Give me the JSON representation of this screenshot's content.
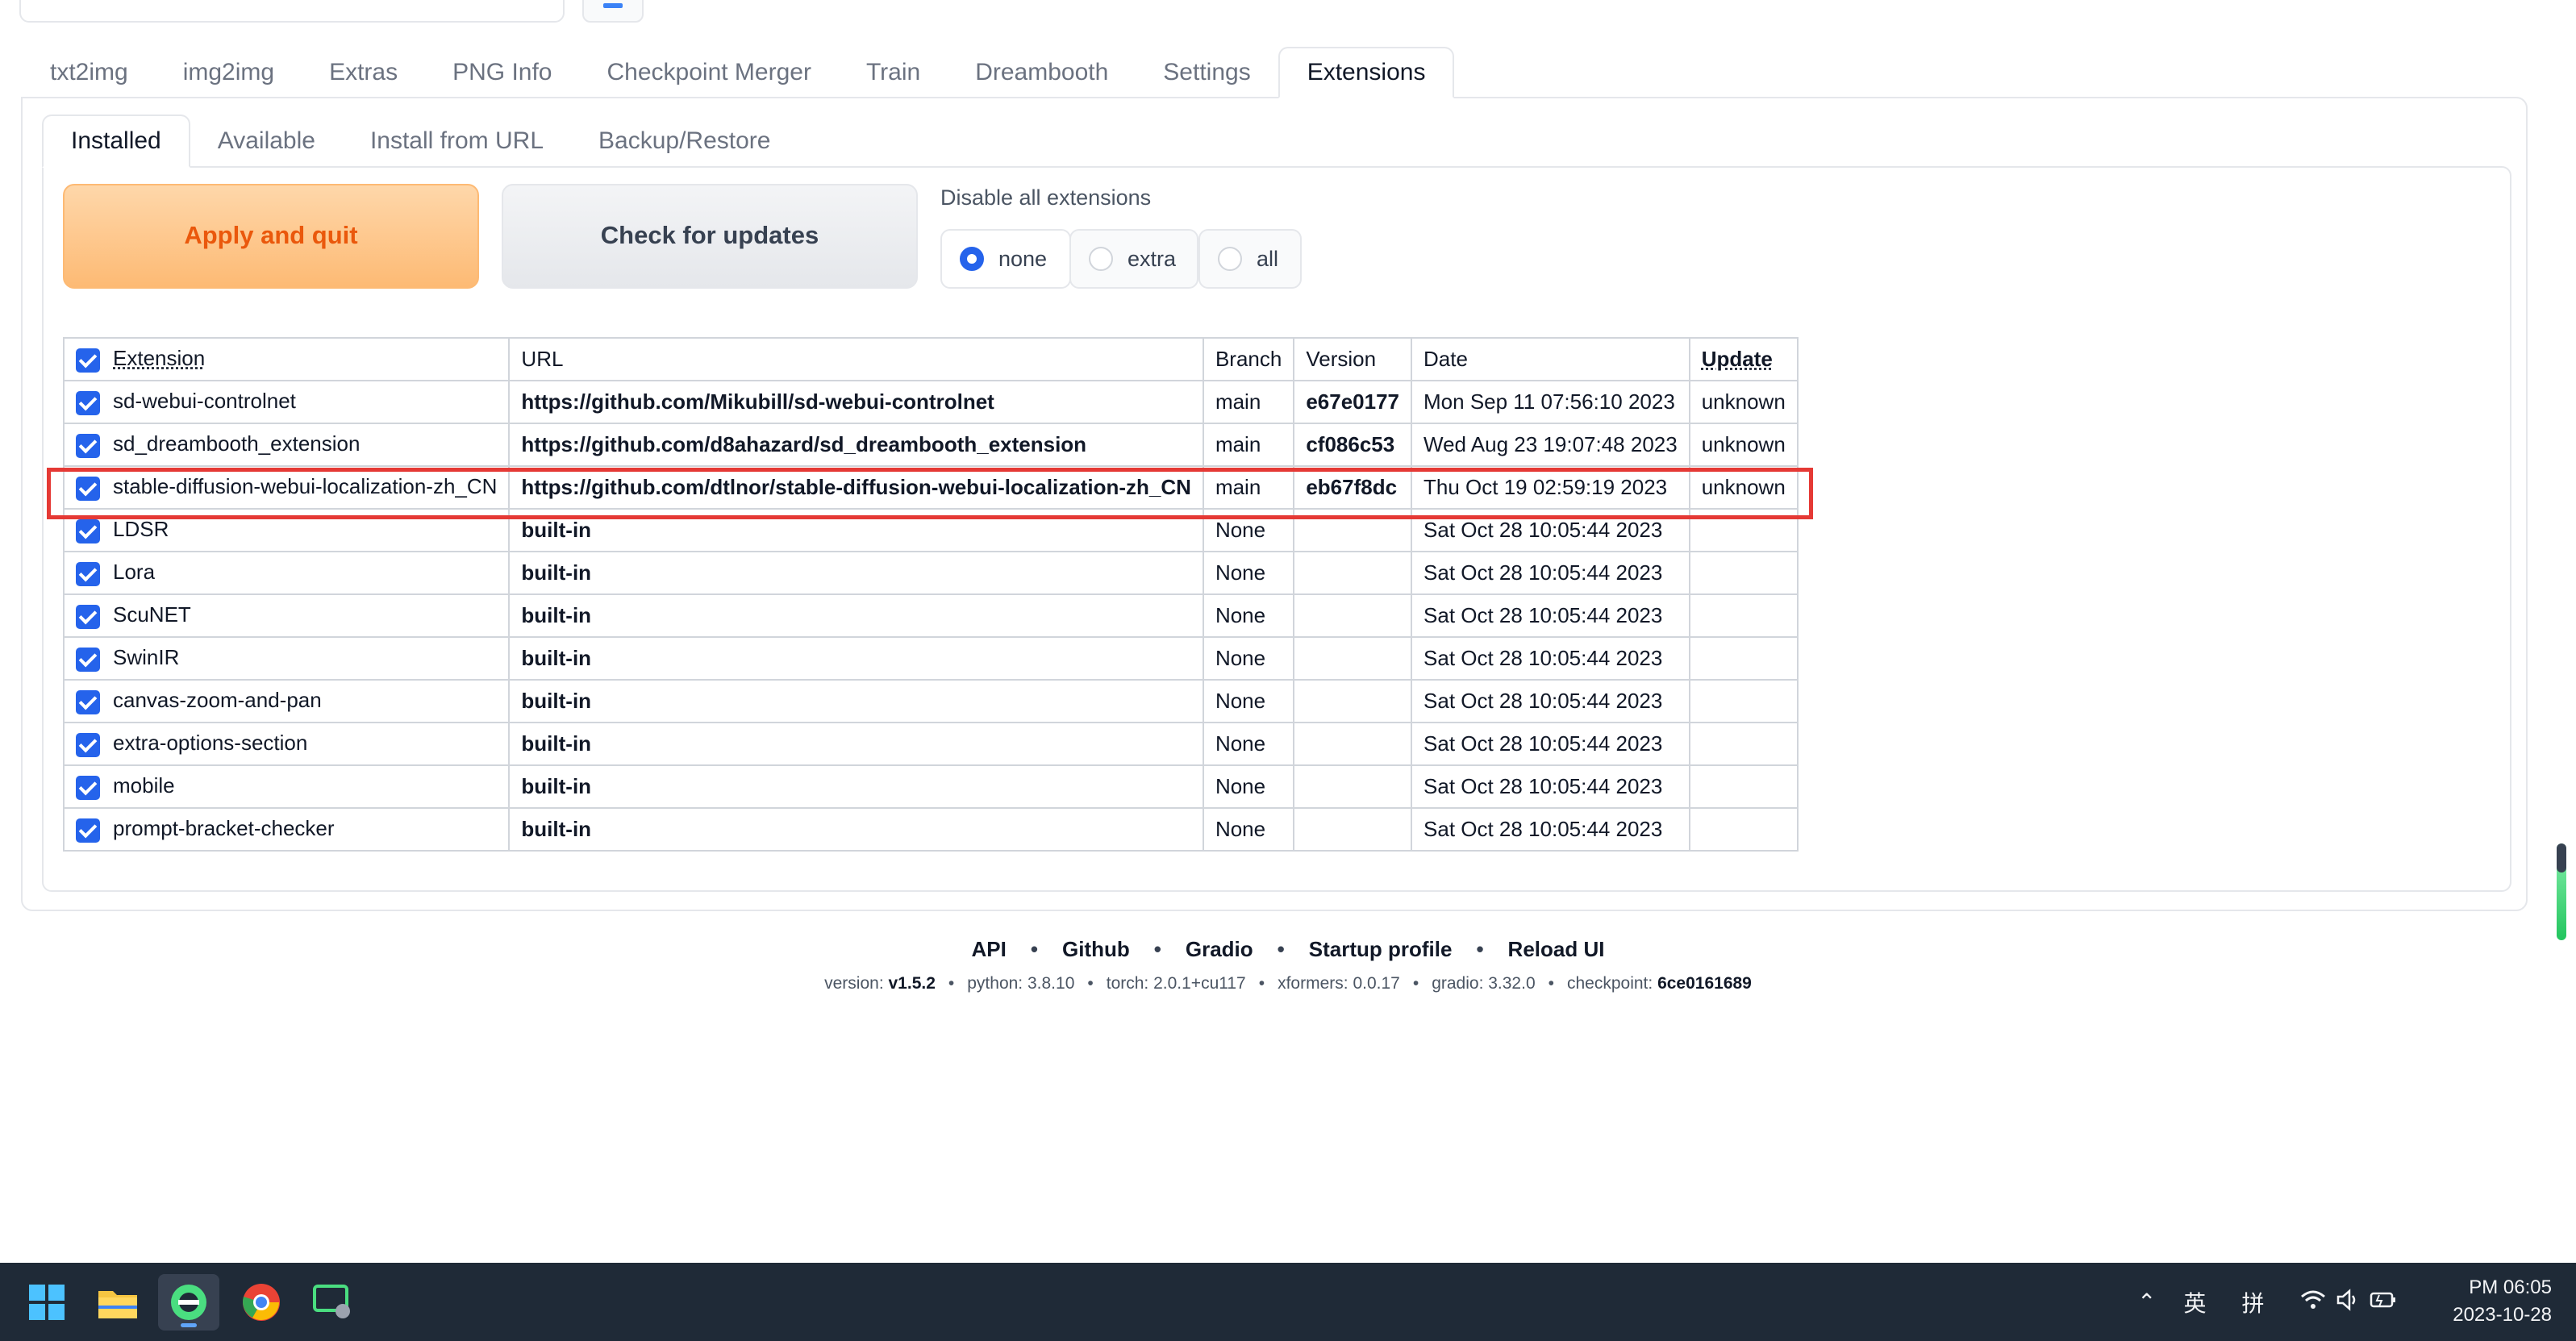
{
  "main_tabs": [
    "txt2img",
    "img2img",
    "Extras",
    "PNG Info",
    "Checkpoint Merger",
    "Train",
    "Dreambooth",
    "Settings",
    "Extensions"
  ],
  "active_main_tab": "Extensions",
  "sub_tabs": [
    "Installed",
    "Available",
    "Install from URL",
    "Backup/Restore"
  ],
  "active_sub_tab": "Installed",
  "buttons": {
    "apply": "Apply and quit",
    "check": "Check for updates"
  },
  "disable": {
    "label": "Disable all extensions",
    "options": [
      "none",
      "extra",
      "all"
    ],
    "selected": "none"
  },
  "table": {
    "headers": [
      "Extension",
      "URL",
      "Branch",
      "Version",
      "Date",
      "Update"
    ],
    "rows": [
      {
        "name": "sd-webui-controlnet",
        "url": "https://github.com/Mikubill/sd-webui-controlnet",
        "branch": "main",
        "version": "e67e0177",
        "date": "Mon Sep 11 07:56:10 2023",
        "update": "unknown"
      },
      {
        "name": "sd_dreambooth_extension",
        "url": "https://github.com/d8ahazard/sd_dreambooth_extension",
        "branch": "main",
        "version": "cf086c53",
        "date": "Wed Aug 23 19:07:48 2023",
        "update": "unknown"
      },
      {
        "name": "stable-diffusion-webui-localization-zh_CN",
        "url": "https://github.com/dtlnor/stable-diffusion-webui-localization-zh_CN",
        "branch": "main",
        "version": "eb67f8dc",
        "date": "Thu Oct 19 02:59:19 2023",
        "update": "unknown"
      },
      {
        "name": "LDSR",
        "url": "built-in",
        "branch": "None",
        "version": "",
        "date": "Sat Oct 28 10:05:44 2023",
        "update": ""
      },
      {
        "name": "Lora",
        "url": "built-in",
        "branch": "None",
        "version": "",
        "date": "Sat Oct 28 10:05:44 2023",
        "update": ""
      },
      {
        "name": "ScuNET",
        "url": "built-in",
        "branch": "None",
        "version": "",
        "date": "Sat Oct 28 10:05:44 2023",
        "update": ""
      },
      {
        "name": "SwinIR",
        "url": "built-in",
        "branch": "None",
        "version": "",
        "date": "Sat Oct 28 10:05:44 2023",
        "update": ""
      },
      {
        "name": "canvas-zoom-and-pan",
        "url": "built-in",
        "branch": "None",
        "version": "",
        "date": "Sat Oct 28 10:05:44 2023",
        "update": ""
      },
      {
        "name": "extra-options-section",
        "url": "built-in",
        "branch": "None",
        "version": "",
        "date": "Sat Oct 28 10:05:44 2023",
        "update": ""
      },
      {
        "name": "mobile",
        "url": "built-in",
        "branch": "None",
        "version": "",
        "date": "Sat Oct 28 10:05:44 2023",
        "update": ""
      },
      {
        "name": "prompt-bracket-checker",
        "url": "built-in",
        "branch": "None",
        "version": "",
        "date": "Sat Oct 28 10:05:44 2023",
        "update": ""
      }
    ]
  },
  "footer": {
    "links": [
      "API",
      "Github",
      "Gradio",
      "Startup profile",
      "Reload UI"
    ],
    "versions": [
      {
        "label": "version: ",
        "value": "v1.5.2",
        "bold": true
      },
      {
        "label": "python: ",
        "value": "3.8.10",
        "bold": false
      },
      {
        "label": "torch: ",
        "value": "2.0.1+cu117",
        "bold": false
      },
      {
        "label": "xformers: ",
        "value": "0.0.17",
        "bold": false
      },
      {
        "label": "gradio: ",
        "value": "3.32.0",
        "bold": false
      },
      {
        "label": "checkpoint: ",
        "value": "6ce0161689",
        "bold": true
      }
    ]
  },
  "taskbar": {
    "icons": [
      "windows-start-icon",
      "file-explorer-icon",
      "browser-app-icon",
      "chrome-icon",
      "terminal-app-icon"
    ],
    "tray": {
      "ime_lang": "英",
      "ime_mode": "拼"
    },
    "clock": {
      "time": "PM 06:05",
      "date": "2023-10-28"
    }
  },
  "colors": {
    "accent": "#2563eb",
    "apply_text": "#ea580c",
    "highlight": "#e53935",
    "taskbar": "#1f2a37"
  }
}
